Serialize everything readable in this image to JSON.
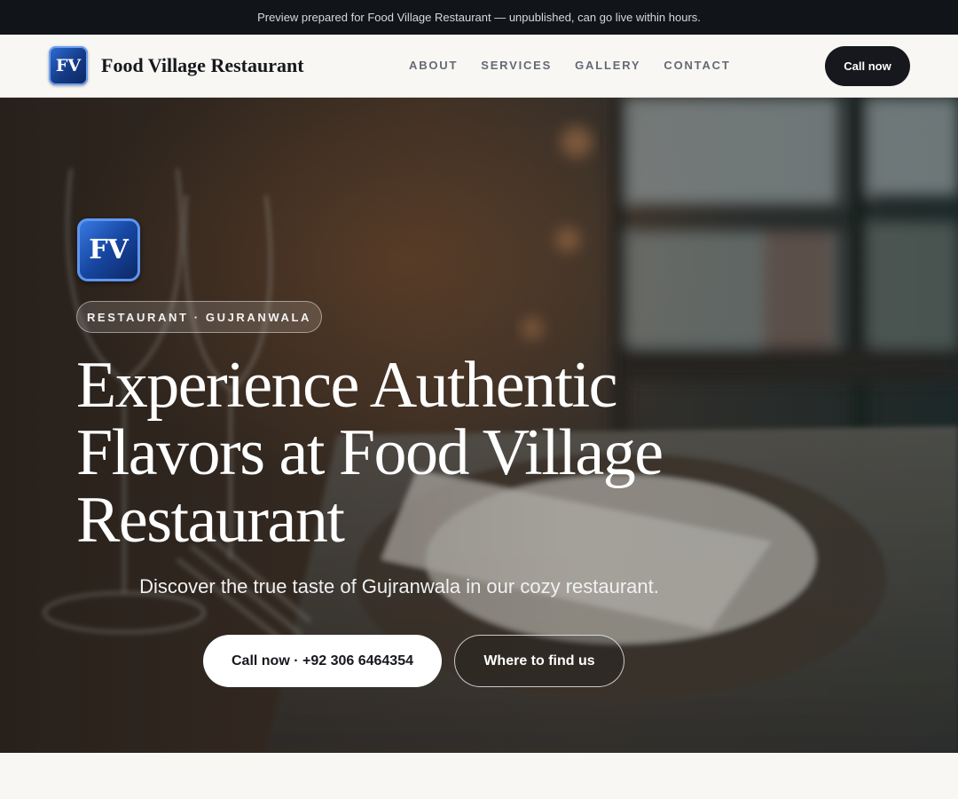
{
  "preview_banner": {
    "text": "Preview prepared for Food Village Restaurant — unpublished, can go live within hours."
  },
  "header": {
    "logo_text": "FV",
    "brand_name": "Food Village Restaurant",
    "nav": [
      {
        "label": "ABOUT"
      },
      {
        "label": "SERVICES"
      },
      {
        "label": "GALLERY"
      },
      {
        "label": "CONTACT"
      }
    ],
    "cta_label": "Call now"
  },
  "hero": {
    "logo_text": "FV",
    "badge": "RESTAURANT · GUJRANWALA",
    "title": "Experience Authentic Flavors at Food Village Restaurant",
    "subtitle": "Discover the true taste of Gujranwala in our cozy restaurant.",
    "primary_button": "Call now · +92 306 6464354",
    "secondary_button": "Where to find us",
    "background_image": "blurred restaurant table with wine glasses, fork, menu and window"
  },
  "colors": {
    "banner_bg": "#111418",
    "nav_bg": "#f8f7f4",
    "dark_button": "#16181d",
    "logo_blue": "#1646a0",
    "hero_text": "#ffffff"
  }
}
